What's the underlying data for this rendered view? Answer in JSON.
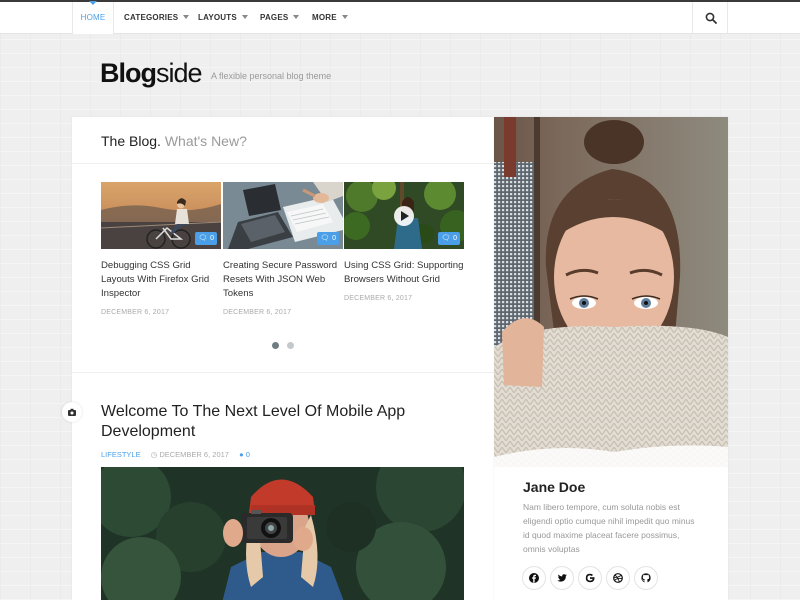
{
  "nav": {
    "items": [
      {
        "label": "HOME",
        "active": true
      },
      {
        "label": "CATEGORIES",
        "dropdown": true
      },
      {
        "label": "LAYOUTS",
        "dropdown": true
      },
      {
        "label": "PAGES",
        "dropdown": true
      },
      {
        "label": "MORE",
        "dropdown": true
      }
    ],
    "search_icon": "search-icon"
  },
  "header": {
    "logo_bold": "Blog",
    "logo_light": "side",
    "tagline": "A flexible personal blog theme"
  },
  "blog_section": {
    "title": "The Blog.",
    "subtitle": "What's New?",
    "posts": [
      {
        "title": "Debugging CSS Grid Layouts With Firefox Grid Inspector",
        "date": "DECEMBER 6, 2017",
        "comments": "0"
      },
      {
        "title": "Creating Secure Password Resets With JSON Web Tokens",
        "date": "DECEMBER 6, 2017",
        "comments": "0"
      },
      {
        "title": "Using CSS Grid: Supporting Browsers Without Grid",
        "date": "DECEMBER 6, 2017",
        "comments": "0"
      }
    ]
  },
  "featured": {
    "title": "Welcome To The Next Level Of Mobile App Development",
    "category": "LIFESTYLE",
    "date": "DECEMBER 6, 2017",
    "comments": "0"
  },
  "profile": {
    "name": "Jane Doe",
    "bio": "Nam libero tempore, cum soluta nobis est eligendi optio cumque nihil impedit quo minus id quod maxime placeat facere possimus, omnis voluptas",
    "social": [
      "facebook-icon",
      "twitter-icon",
      "google-icon",
      "dribbble-icon",
      "github-icon"
    ]
  },
  "colors": {
    "accent": "#4a9fe8",
    "text": "#333333",
    "muted": "#999999",
    "background": "#efefef"
  }
}
